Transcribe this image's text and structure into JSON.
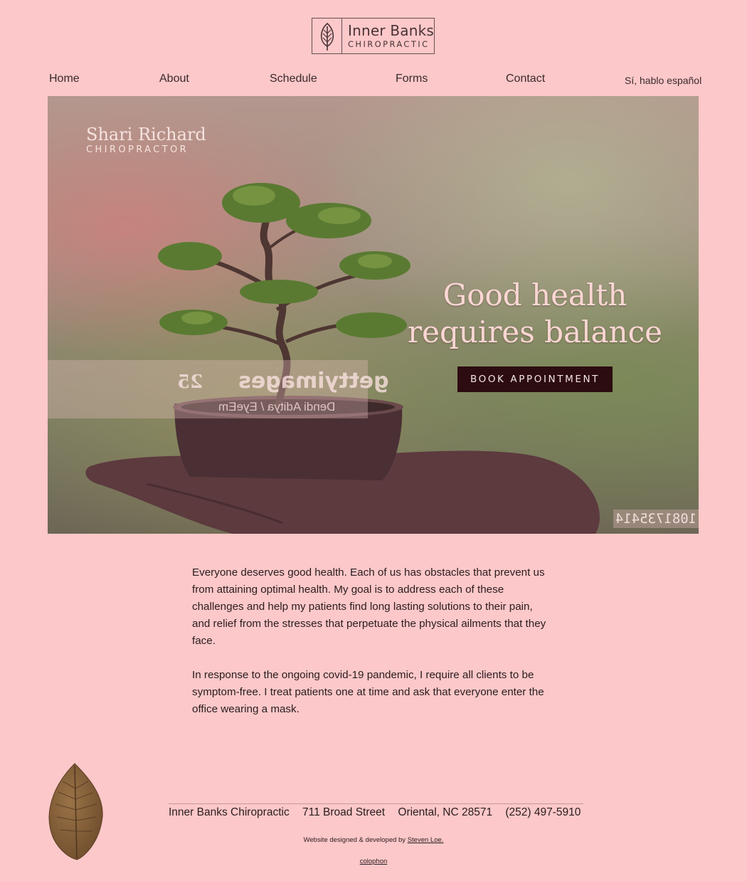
{
  "logo": {
    "name": "Inner Banks",
    "subtitle": "CHIROPRACTIC",
    "icon": "leaf-icon"
  },
  "nav": {
    "items": [
      "Home",
      "About",
      "Schedule",
      "Forms",
      "Contact"
    ],
    "spanish": "Sí, hablo español"
  },
  "hero": {
    "doctor_name": "Shari Richard",
    "doctor_title": "CHIROPRACTOR",
    "headline_line1": "Good health",
    "headline_line2": "requires balance",
    "cta": "BOOK APPOINTMENT",
    "watermark": "gettyimages",
    "watermark_years": "25",
    "watermark_credit": "Dendi Aditya / EyeEm",
    "image_id": "1081735414"
  },
  "content": {
    "paragraph1": "Everyone deserves good health. Each of us has obstacles that prevent us from attaining optimal health. My goal is to address each of these challenges and help my patients find long lasting solutions to their pain, and relief from the stresses that perpetuate the physical ailments that they face.",
    "paragraph2": "In response to the ongoing covid-19 pandemic, I require all clients to be symptom-free. I treat patients one at time and ask that everyone enter the office wearing a mask."
  },
  "footer": {
    "business": "Inner Banks Chiropractic",
    "street": "711 Broad Street",
    "city": "Oriental, NC  28571",
    "phone": "(252) 497-5910",
    "credit_prefix": "Website designed & developed by",
    "credit_link": "Steven Loe.",
    "colophon": "colophon"
  },
  "colors": {
    "background": "#fcc8c9",
    "button": "#2c0c10",
    "headline": "#fbd6d4"
  }
}
